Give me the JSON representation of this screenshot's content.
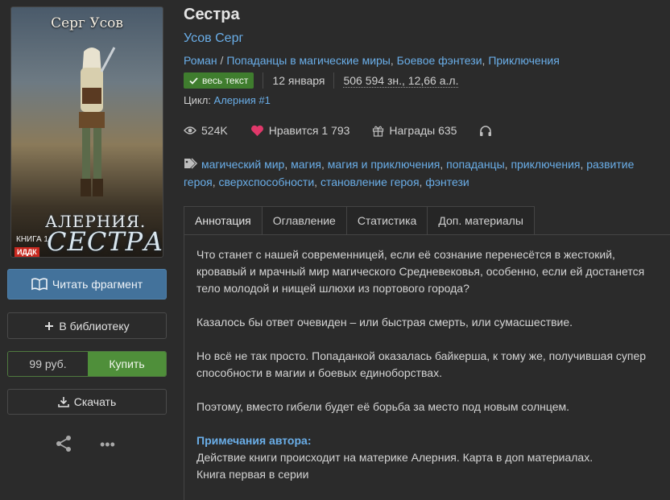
{
  "cover": {
    "author": "Серг Усов",
    "series_title": "АЛЕРНИЯ.",
    "book_title": "СЕСТРА",
    "book_number": "КНИГА 1",
    "publisher": "ИДДК"
  },
  "actions": {
    "read_fragment": "Читать фрагмент",
    "add_library": "В библиотеку",
    "price": "99 руб.",
    "buy": "Купить",
    "download": "Скачать",
    "more": "•••"
  },
  "book": {
    "title": "Сестра",
    "author": "Усов Серг",
    "genres": [
      "Роман",
      "Попаданцы в магические миры",
      "Боевое фэнтези",
      "Приключения"
    ],
    "status_badge": "весь текст",
    "date": "12 января",
    "chars": "506 594 зн., 12,66 а.л.",
    "cycle_label": "Цикл:",
    "cycle_name": "Алерния #1"
  },
  "stats": {
    "views": "524K",
    "likes": "Нравится 1 793",
    "awards": "Награды 635"
  },
  "tags": [
    "магический мир",
    "магия",
    "магия и приключения",
    "попаданцы",
    "приключения",
    "развитие героя",
    "сверхспособности",
    "становление героя",
    "фэнтези"
  ],
  "tabs": [
    "Аннотация",
    "Оглавление",
    "Статистика",
    "Доп. материалы"
  ],
  "annotation": {
    "p1": "Что станет с нашей современницей, если её сознание перенесётся в жестокий, кровавый и мрачный мир магического Средневековья, особенно, если ей достанется тело молодой и нищей шлюхи из портового города?",
    "p2": "Казалось бы ответ очевиден – или быстрая смерть, или сумасшествие.",
    "p3": "Но всё не так просто. Попаданкой оказалась байкерша, к тому же, получившая супер способности в магии и боевых единоборствах.",
    "p4": "Поэтому, вместо гибели будет её борьба за место под новым солнцем.",
    "notes_title": "Примечания автора:",
    "notes_line1": "Действие книги происходит на материке Алерния. Карта в доп материалах.",
    "notes_line2": "Книга первая в серии"
  },
  "colors": {
    "accent": "#6aaee8",
    "read_button": "#43729b",
    "buy_button": "#4f8f3a",
    "badge": "#3f7d2e",
    "heart": "#e0386a"
  }
}
